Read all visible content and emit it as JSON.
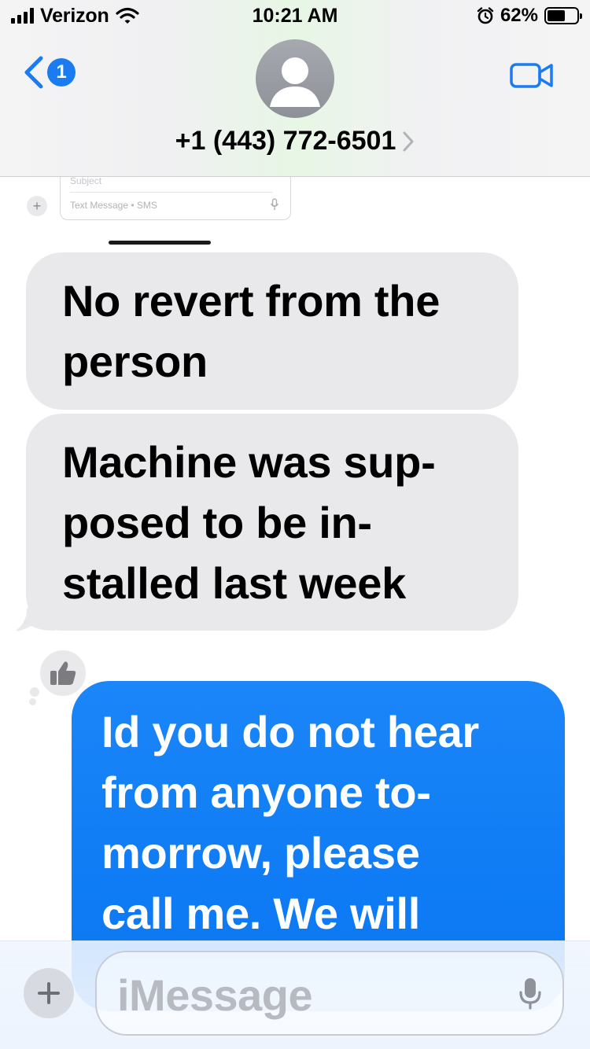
{
  "status_bar": {
    "carrier": "Verizon",
    "time": "10:21 AM",
    "battery_percent": "62%",
    "battery_level": 0.62,
    "icons": [
      "signal-bars-icon",
      "wifi-icon",
      "alarm-icon",
      "battery-icon"
    ]
  },
  "header": {
    "back_badge_count": "1",
    "contact": "+1 (443) 772-6501",
    "icons": [
      "back-chevron-icon",
      "avatar-silhouette-icon",
      "chevron-right-icon",
      "video-camera-icon"
    ]
  },
  "old_composer": {
    "subject_placeholder": "Subject",
    "text_placeholder": "Text Message • SMS"
  },
  "messages": [
    {
      "direction": "incoming",
      "lines": [
        "No revert from the",
        "person"
      ]
    },
    {
      "direction": "incoming",
      "lines": [
        "Machine was sup-",
        "posed to be in-",
        "stalled last week"
      ]
    },
    {
      "direction": "outgoing",
      "lines": [
        "Id you do not hear",
        "from anyone to-",
        "morrow, please",
        "call me. We will"
      ]
    }
  ],
  "tapback": {
    "icon": "thumbs-up-icon"
  },
  "composer": {
    "placeholder": "iMessage",
    "icons": [
      "plus-icon",
      "microphone-icon"
    ]
  },
  "colors": {
    "accent_blue": "#1b7bf0",
    "outgoing_bubble": "#0f7cf5",
    "incoming_bubble": "#e9e9eb"
  }
}
